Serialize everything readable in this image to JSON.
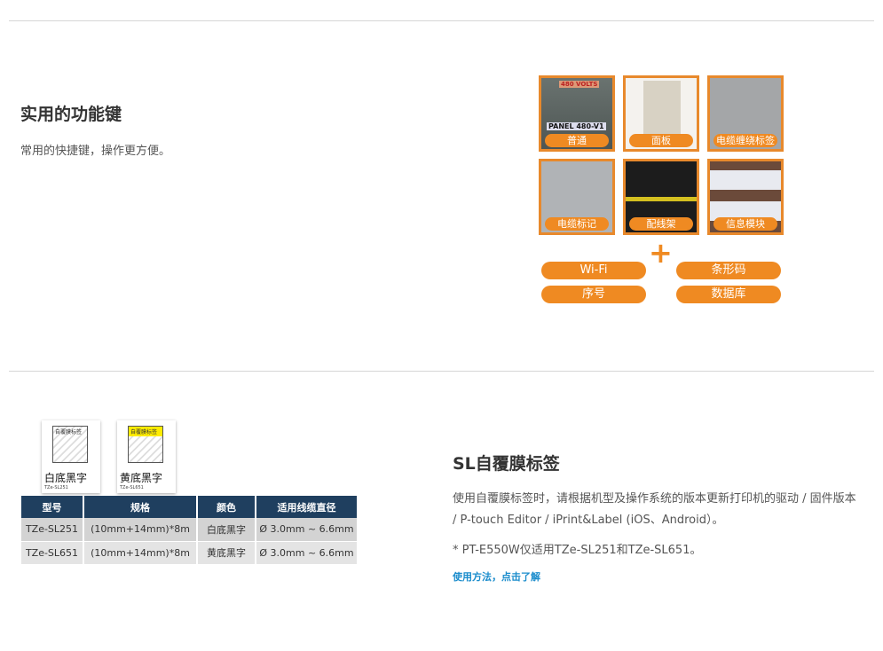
{
  "section1": {
    "title": "实用的功能键",
    "description": "常用的快捷键，操作更方便。",
    "tiles": [
      {
        "label": "普通",
        "photo_text": "PANEL 480-V1",
        "photo_sub": "480 VOLTS"
      },
      {
        "label": "面板"
      },
      {
        "label": "电缆缠绕标签"
      },
      {
        "label": "电缆标记"
      },
      {
        "label": "配线架"
      },
      {
        "label": "信息模块"
      }
    ],
    "plus": "+",
    "features": [
      "Wi-Fi",
      "条形码",
      "序号",
      "数据库"
    ]
  },
  "section2": {
    "title": "SL自覆膜标签",
    "description": "使用自覆膜标签时，请根据机型及操作系统的版本更新打印机的驱动 / 固件版本 / P-touch Editor / iPrint&Label (iOS、Android）。",
    "note": "* PT-E550W仅适用TZe-SL251和TZe-SL651。",
    "link": "使用方法，点击了解",
    "cards": [
      {
        "header": "自覆膜标签",
        "name": "白底黑字",
        "model": "TZe-SL251",
        "color": "#ffffff"
      },
      {
        "header": "自覆膜标签",
        "name": "黄底黑字",
        "model": "TZe-SL651",
        "color": "#ffec00"
      }
    ],
    "table": {
      "headers": [
        "型号",
        "规格",
        "颜色",
        "适用线缆直径"
      ],
      "rows": [
        [
          "TZe-SL251",
          "(10mm+14mm)*8m",
          "白底黑字",
          "Ø 3.0mm ~ 6.6mm"
        ],
        [
          "TZe-SL651",
          "(10mm+14mm)*8m",
          "黄底黑字",
          "Ø 3.0mm ~ 6.6mm"
        ]
      ]
    }
  },
  "colors": {
    "accent": "#ef8a22",
    "link": "#1a8ccc",
    "table_header": "#1f3f5f"
  }
}
